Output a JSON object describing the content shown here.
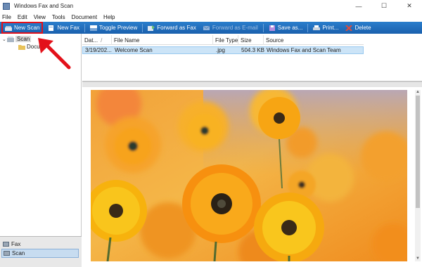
{
  "window": {
    "title": "Windows Fax and Scan",
    "controls": {
      "minimize": "—",
      "maximize": "☐",
      "close": "✕"
    }
  },
  "menu": [
    "File",
    "Edit",
    "View",
    "Tools",
    "Document",
    "Help"
  ],
  "toolbar": {
    "new_scan": "New Scan",
    "new_fax": "New Fax",
    "toggle_preview": "Toggle Preview",
    "forward_as_fax": "Forward as Fax",
    "forward_as_email": "Forward as E-mail",
    "save_as": "Save as...",
    "print": "Print...",
    "delete": "Delete"
  },
  "tree": {
    "root": "Scan",
    "child": "Docu"
  },
  "bottom_nav": {
    "fax": "Fax",
    "scan": "Scan"
  },
  "list": {
    "columns": [
      "Dat...",
      "File Name",
      "File Type",
      "Size",
      "Source"
    ],
    "sort_indicator": "/",
    "rows": [
      {
        "date": "3/19/202...",
        "file_name": "Welcome Scan",
        "file_type": ".jpg",
        "size": "504.3 KB",
        "source": "Windows Fax and Scan Team"
      }
    ]
  },
  "colors": {
    "toolbar": "#1f6dbd",
    "highlight": "#e3111a",
    "selection": "#cce4f7"
  }
}
